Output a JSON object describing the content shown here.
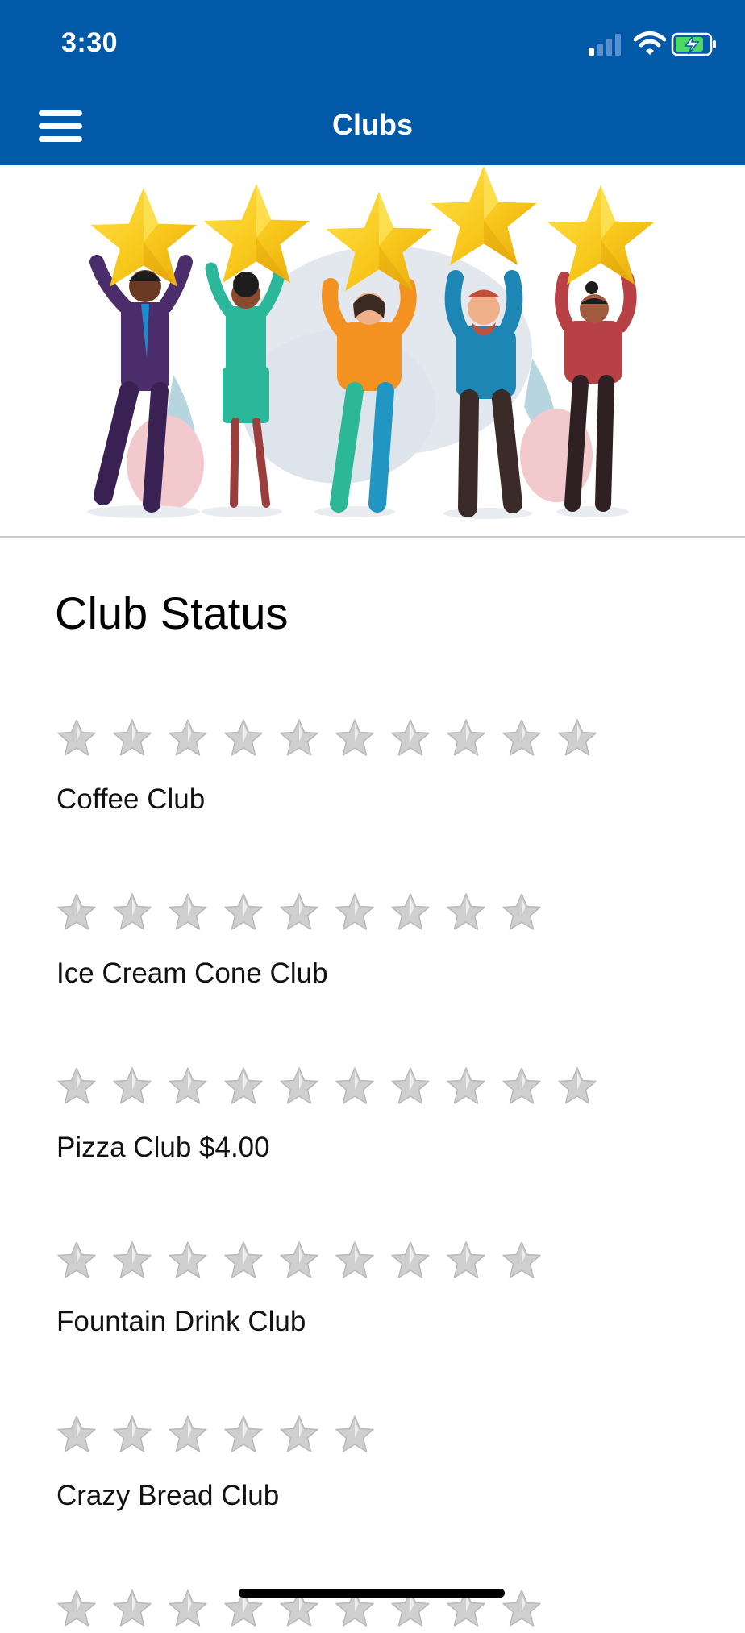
{
  "status_bar": {
    "time": "3:30",
    "icons": [
      "signal-icon",
      "wifi-icon",
      "battery-charging-icon"
    ]
  },
  "header": {
    "menu_icon": "hamburger-menu-icon",
    "title": "Clubs"
  },
  "hero": {
    "illustration": "five-people-holding-stars",
    "accent": "#f7c51d"
  },
  "main": {
    "title": "Club Status",
    "clubs": [
      {
        "label": "Coffee Club",
        "stars": 10
      },
      {
        "label": "Ice Cream Cone Club",
        "stars": 9
      },
      {
        "label": "Pizza Club $4.00",
        "stars": 10
      },
      {
        "label": "Fountain Drink Club",
        "stars": 9
      },
      {
        "label": "Crazy Bread Club",
        "stars": 6
      },
      {
        "label": "",
        "stars": 9
      }
    ]
  },
  "colors": {
    "header_bg": "#0259a8",
    "star_empty": "#cfcfcf",
    "battery": "#4cd964"
  }
}
